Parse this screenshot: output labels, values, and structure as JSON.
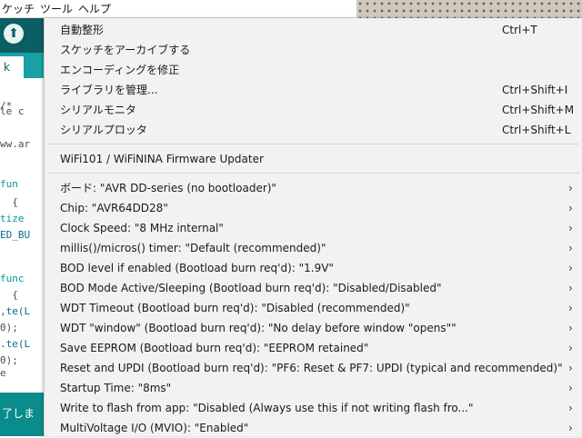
{
  "ide": {
    "menubar": [
      "ケッチ",
      "ツール",
      "ヘルプ"
    ],
    "tab_label": "k",
    "code_lines": [
      "/*",
      "le c",
      "",
      "ww.ar",
      "",
      "",
      "",
      "fun",
      "  {",
      "tize",
      "ED_BU",
      "",
      "",
      "func",
      "  {",
      ",te(L",
      "0);",
      ".te(L",
      "0);",
      "e"
    ],
    "console_text": "了しま"
  },
  "menu": {
    "group1": [
      {
        "label": "自動整形",
        "shortcut": "Ctrl+T"
      },
      {
        "label": "スケッチをアーカイブする",
        "shortcut": ""
      },
      {
        "label": "エンコーディングを修正",
        "shortcut": ""
      },
      {
        "label": "ライブラリを管理...",
        "shortcut": "Ctrl+Shift+I"
      },
      {
        "label": "シリアルモニタ",
        "shortcut": "Ctrl+Shift+M"
      },
      {
        "label": "シリアルプロッタ",
        "shortcut": "Ctrl+Shift+L"
      }
    ],
    "group2": [
      {
        "label": "WiFi101 / WiFiNINA Firmware Updater"
      }
    ],
    "group3": [
      {
        "label": "ボード: \"AVR DD-series (no bootloader)\""
      },
      {
        "label": "Chip: \"AVR64DD28\""
      },
      {
        "label": "Clock Speed: \"8 MHz internal\""
      },
      {
        "label": "millis()/micros() timer: \"Default (recommended)\""
      },
      {
        "label": "BOD level if enabled (Bootload burn req'd): \"1.9V\""
      },
      {
        "label": "BOD Mode Active/Sleeping (Bootload burn req'd): \"Disabled/Disabled\""
      },
      {
        "label": "WDT Timeout (Bootload burn req'd): \"Disabled (recommended)\""
      },
      {
        "label": "WDT \"window\" (Bootload burn req'd): \"No delay before window \"opens\"\""
      },
      {
        "label": "Save EEPROM (Bootload burn req'd): \"EEPROM retained\""
      },
      {
        "label": "Reset and UPDI (Bootload burn req'd): \"PF6: Reset & PF7: UPDI (typical and recommended)\""
      },
      {
        "label": "Startup Time: \"8ms\""
      },
      {
        "label": "Write to flash from app: \"Disabled (Always use this if not writing flash fro...\""
      },
      {
        "label": "MultiVoltage I/O (MVIO): \"Enabled\""
      }
    ],
    "submenu_arrow": "›"
  },
  "colors": {
    "ide_teal": "#0b5e63",
    "ide_accent": "#17a1a5",
    "menu_bg": "#f2f2f2"
  }
}
